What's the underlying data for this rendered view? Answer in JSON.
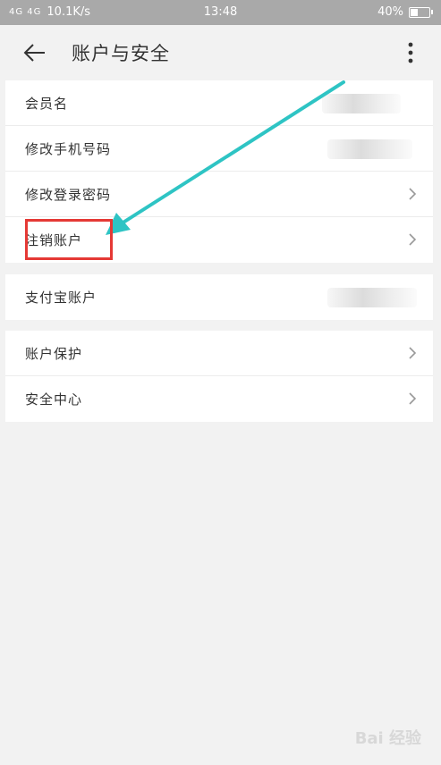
{
  "statusbar": {
    "signal": "4G 4G",
    "speed": "10.1K/s",
    "time": "13:48",
    "battery": "40%",
    "battery_level": 0.4
  },
  "appbar": {
    "title": "账户与安全",
    "back_icon": "arrow-left-icon",
    "more_icon": "more-vertical-icon"
  },
  "groups": [
    {
      "rows": [
        {
          "label": "会员名",
          "value": ""
        },
        {
          "label": "修改手机号码",
          "value": ""
        },
        {
          "label": "修改登录密码",
          "chevron": true
        },
        {
          "label": "注销账户",
          "chevron": true
        }
      ]
    },
    {
      "rows": [
        {
          "label": "支付宝账户",
          "value": ""
        }
      ]
    },
    {
      "rows": [
        {
          "label": "账户保护",
          "chevron": true
        },
        {
          "label": "安全中心",
          "chevron": true
        }
      ]
    }
  ],
  "annotation": {
    "highlight_color": "#e53935",
    "arrow_color": "#2ec4c4"
  },
  "watermark": "Bai 经验"
}
